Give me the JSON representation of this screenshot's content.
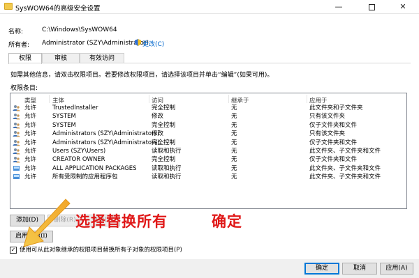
{
  "window": {
    "title": "SysWOW64的高级安全设置",
    "minimize": "—",
    "close": "✕"
  },
  "props": {
    "name_label": "名称:",
    "name_value": "C:\\Windows\\SysWOW64",
    "owner_label": "所有者:",
    "owner_value": "Administrator (SZY\\Administrator)",
    "change_link": "更改(C)"
  },
  "tabs": [
    {
      "label": "权限",
      "active": true
    },
    {
      "label": "审核",
      "active": false
    },
    {
      "label": "有效访问",
      "active": false
    }
  ],
  "info_text": "如需其他信息，请双击权限项目。若要修改权限项目，请选择该项目并单击“编辑”(如果可用)。",
  "entries_label": "权限条目:",
  "columns": [
    "类型",
    "主体",
    "访问",
    "继承于",
    "应用于"
  ],
  "rows": [
    {
      "type": "允许",
      "principal": "TrustedInstaller",
      "access": "完全控制",
      "inherited": "无",
      "applies": "此文件夹和子文件夹",
      "icon": "user-group-icon"
    },
    {
      "type": "允许",
      "principal": "SYSTEM",
      "access": "修改",
      "inherited": "无",
      "applies": "只有该文件夹",
      "icon": "user-group-icon"
    },
    {
      "type": "允许",
      "principal": "SYSTEM",
      "access": "完全控制",
      "inherited": "无",
      "applies": "仅子文件夹和文件",
      "icon": "user-group-icon"
    },
    {
      "type": "允许",
      "principal": "Administrators (SZY\\Administrators)",
      "access": "修改",
      "inherited": "无",
      "applies": "只有该文件夹",
      "icon": "user-group-icon"
    },
    {
      "type": "允许",
      "principal": "Administrators (SZY\\Administrators)",
      "access": "完全控制",
      "inherited": "无",
      "applies": "仅子文件夹和文件",
      "icon": "user-group-icon"
    },
    {
      "type": "允许",
      "principal": "Users (SZY\\Users)",
      "access": "读取和执行",
      "inherited": "无",
      "applies": "此文件夹、子文件夹和文件",
      "icon": "user-group-icon"
    },
    {
      "type": "允许",
      "principal": "CREATOR OWNER",
      "access": "完全控制",
      "inherited": "无",
      "applies": "仅子文件夹和文件",
      "icon": "user-group-icon"
    },
    {
      "type": "允许",
      "principal": "ALL APPLICATION PACKAGES",
      "access": "读取和执行",
      "inherited": "无",
      "applies": "此文件夹、子文件夹和文件",
      "icon": "app-package-icon"
    },
    {
      "type": "允许",
      "principal": "所有受限制的应用程序包",
      "access": "读取和执行",
      "inherited": "无",
      "applies": "此文件夹、子文件夹和文件",
      "icon": "app-package-icon"
    }
  ],
  "buttons": {
    "add": "添加(D)",
    "remove": "删除(R)",
    "view": "查看(V)",
    "enable_inheritance": "启用继承(I)",
    "ok": "确定",
    "cancel": "取消",
    "apply": "应用(A)"
  },
  "replace_checkbox": {
    "label": "使用可从此对象继承的权限项目替换所有子对象的权限项目(P)",
    "checked": true
  },
  "annotations": {
    "replace_all": "选择替换所有",
    "confirm": "确定",
    "color": "#e01818"
  }
}
